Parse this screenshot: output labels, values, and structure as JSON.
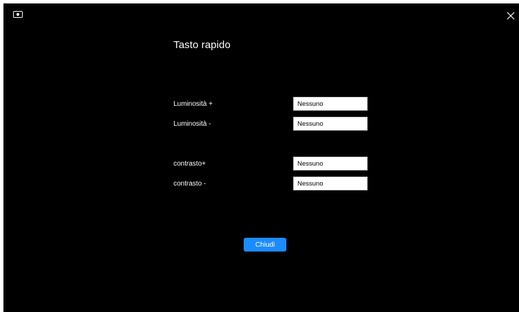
{
  "window": {
    "close_icon": "close-icon",
    "app_icon": "monitor-settings-icon"
  },
  "dialog": {
    "title": "Tasto rapido",
    "rows": [
      {
        "label": "Luminosità +",
        "value": "Nessuno"
      },
      {
        "label": "Luminosità -",
        "value": "Nessuno"
      },
      {
        "label": "contrasto+",
        "value": "Nessuno"
      },
      {
        "label": "contrasto -",
        "value": "Nessuno"
      }
    ],
    "close_button_label": "Chiudi"
  },
  "colors": {
    "background": "#000000",
    "accent": "#1a8cff",
    "text": "#ffffff",
    "field_background": "#ffffff"
  }
}
